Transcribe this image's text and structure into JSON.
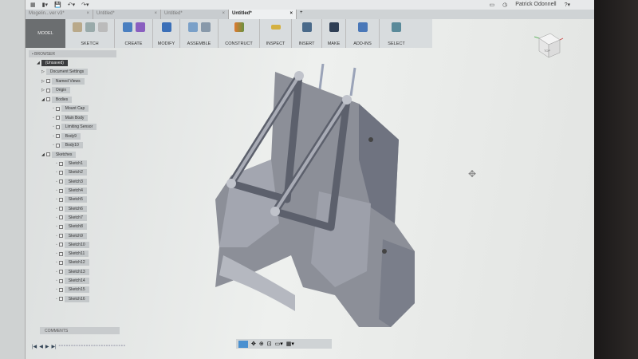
{
  "user": "Patrick Odonnell",
  "tabs": [
    {
      "label": "Mogelin...ver v3*",
      "active": false
    },
    {
      "label": "Untitled*",
      "active": false
    },
    {
      "label": "Untitled*",
      "active": false
    },
    {
      "label": "Untitled*",
      "active": true
    }
  ],
  "ribbon": {
    "workspace": "MODEL",
    "groups": [
      "SKETCH",
      "CREATE",
      "MODIFY",
      "ASSEMBLE",
      "CONSTRUCT",
      "INSPECT",
      "INSERT",
      "MAKE",
      "ADD-INS",
      "SELECT"
    ]
  },
  "browser": {
    "title": "BROWSER",
    "root": "(Unsaved)",
    "items": [
      "Document Settings",
      "Named Views",
      "Origin",
      "Bodies"
    ],
    "bodies": [
      "Mount Cap",
      "Main Body",
      "Limiting Sensor",
      "Body9",
      "Body10"
    ],
    "sketches_label": "Sketches",
    "sketches": [
      "Sketch1",
      "Sketch2",
      "Sketch3",
      "Sketch4",
      "Sketch5",
      "Sketch6",
      "Sketch7",
      "Sketch8",
      "Sketch9",
      "Sketch10",
      "Sketch11",
      "Sketch12",
      "Sketch13",
      "Sketch14",
      "Sketch15",
      "Sketch16"
    ]
  },
  "comments": "COMMENTS",
  "viewcube": "TOP"
}
